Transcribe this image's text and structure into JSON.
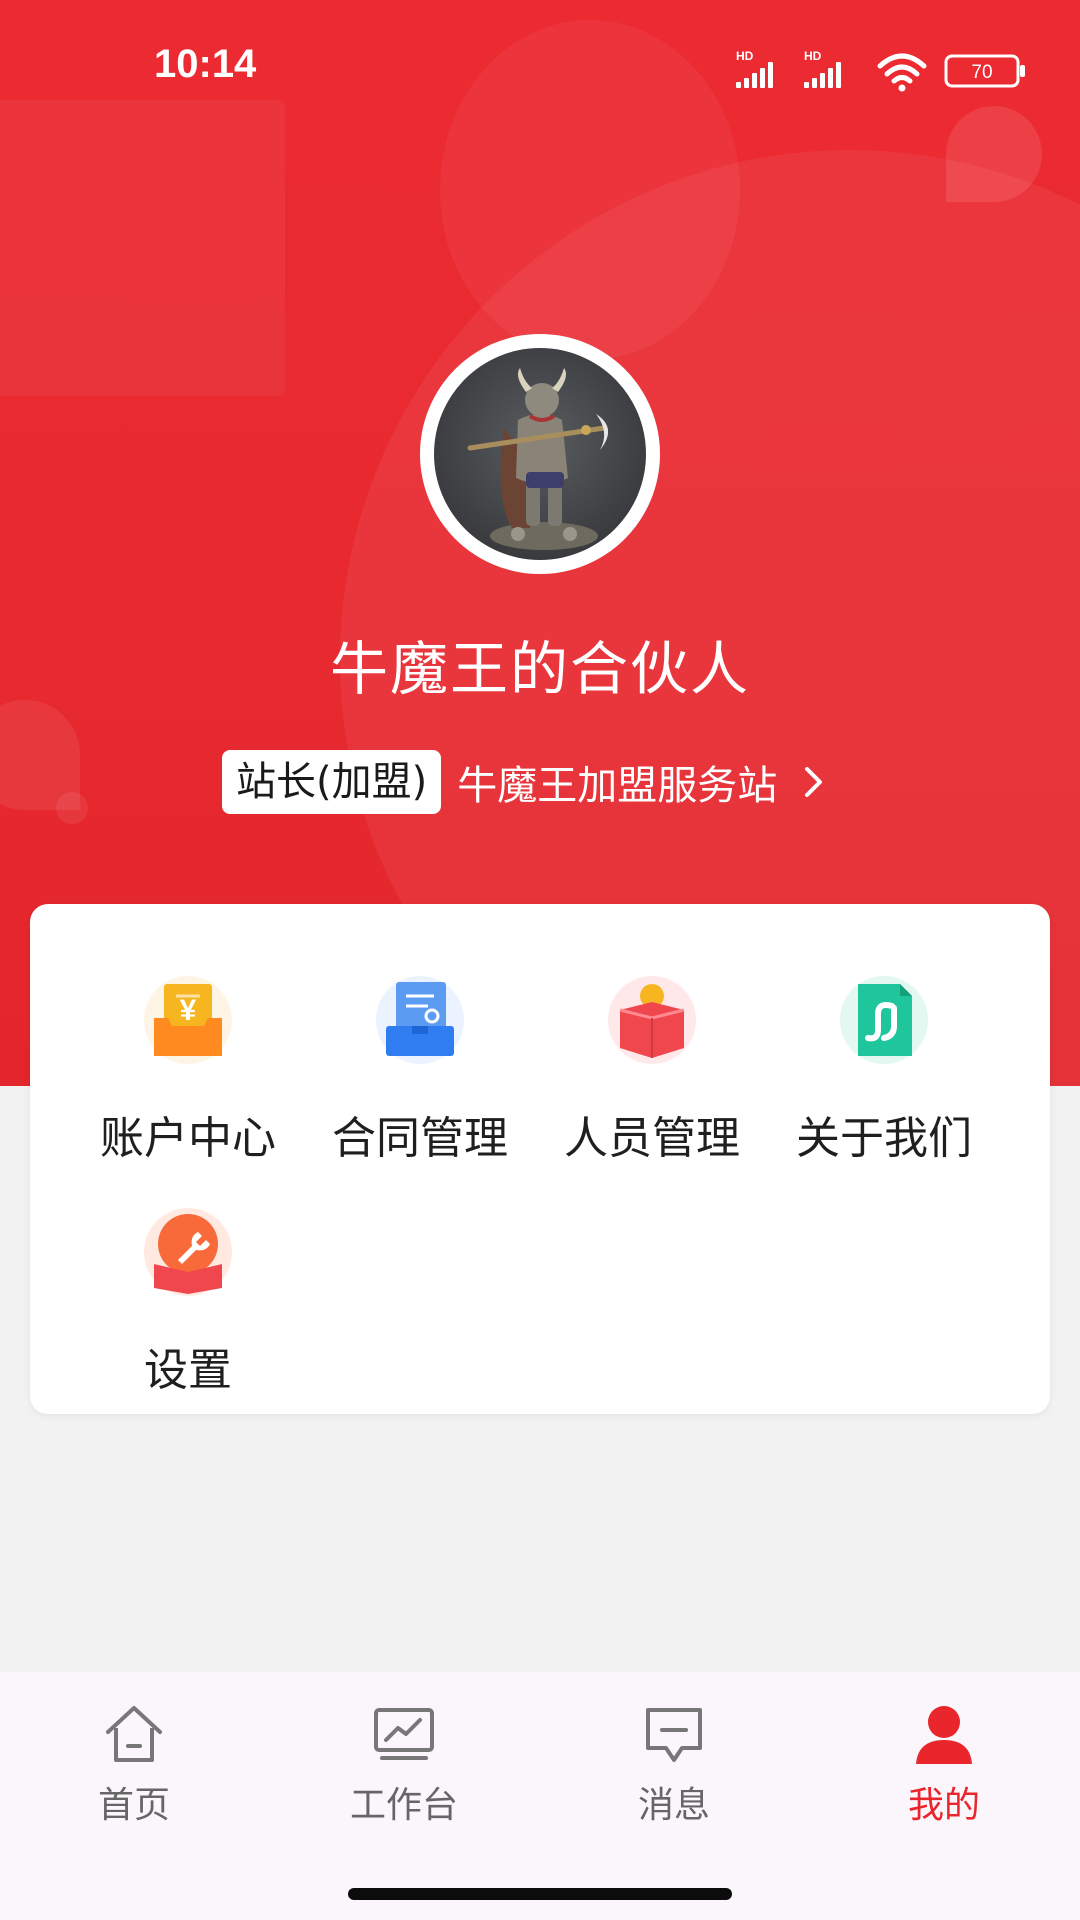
{
  "status_bar": {
    "time": "10:14",
    "network_1": "HD",
    "network_2": "HD",
    "battery": "70"
  },
  "profile": {
    "name": "牛魔王的合伙人",
    "role_badge": "站长(加盟)",
    "station_name": "牛魔王加盟服务站"
  },
  "menu": {
    "items": [
      {
        "label": "账户中心",
        "icon": "account-wallet-icon"
      },
      {
        "label": "合同管理",
        "icon": "contract-document-icon"
      },
      {
        "label": "人员管理",
        "icon": "personnel-box-icon"
      },
      {
        "label": "关于我们",
        "icon": "about-us-icon"
      },
      {
        "label": "设置",
        "icon": "settings-wrench-icon"
      }
    ]
  },
  "tabbar": {
    "tabs": [
      {
        "label": "首页",
        "icon": "home-icon"
      },
      {
        "label": "工作台",
        "icon": "workbench-icon"
      },
      {
        "label": "消息",
        "icon": "message-icon"
      },
      {
        "label": "我的",
        "icon": "profile-person-icon"
      }
    ],
    "active_tab": "我的",
    "active_color": "#e8262c",
    "inactive_color": "#666666"
  },
  "colors": {
    "header_red": "#ea2a31",
    "page_background": "#f2f2f2"
  }
}
